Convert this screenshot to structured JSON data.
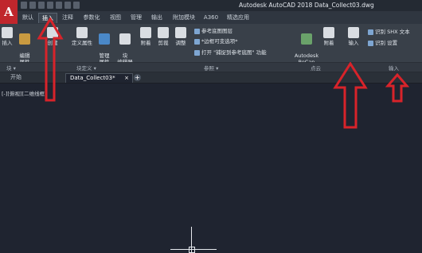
{
  "window": {
    "app_logo": "A",
    "title": "Autodesk AutoCAD 2018    Data_Collect03.dwg"
  },
  "ribbon_tabs": [
    "默认",
    "插入",
    "注释",
    "参数化",
    "视图",
    "管理",
    "输出",
    "附加模块",
    "A360",
    "精选应用"
  ],
  "active_tab": "插入",
  "ribbon": {
    "insert_label": "插入",
    "edit_attr_label": "编辑\n属性",
    "create_label": "创建",
    "define_attr_label": "定义属性",
    "manage_attr_label": "管理\n属性",
    "block_editor_label": "块\n编辑器",
    "attach_label": "附着",
    "clip_label": "剪裁",
    "adjust_label": "调整",
    "ref_underlay_layers": "参考底图图层",
    "frame_vary": "*边框可变选项*",
    "snap_open": "打开 \"捕捉到参考底图\" 功能",
    "recap_label": "Autodesk\nReCap",
    "attach2_label": "附着",
    "import_label": "输入",
    "recognize_shx": "识别 SHX 文本",
    "recognize_settings": "识别 设置"
  },
  "panels": {
    "block": "块 ▾",
    "block_def": "块定义 ▾",
    "reference": "参照 ▾",
    "point_cloud": "点云",
    "import": "输入"
  },
  "file_tabs": {
    "start": "开始",
    "drawing": "Data_Collect03*",
    "close": "×",
    "new": "+"
  },
  "viewport": {
    "label": "[-][俯视][二维线框]"
  },
  "colors": {
    "arrow": "#d8232a",
    "accent_red": "#c0262c"
  }
}
